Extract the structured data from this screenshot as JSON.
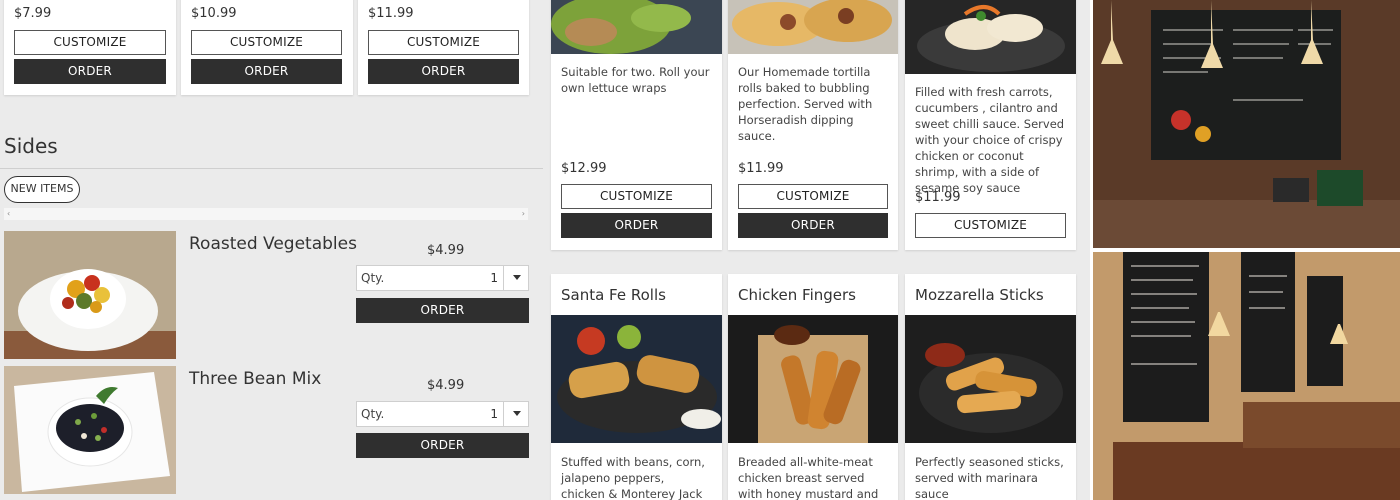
{
  "top_row": [
    {
      "price": "$7.99",
      "customize": "CUSTOMIZE",
      "order": "ORDER"
    },
    {
      "price": "$10.99",
      "customize": "CUSTOMIZE",
      "order": "ORDER"
    },
    {
      "price": "$11.99",
      "customize": "CUSTOMIZE",
      "order": "ORDER"
    }
  ],
  "sides": {
    "title": "Sides",
    "filter_pill": "NEW ITEMS",
    "items": [
      {
        "name": "Roasted Vegetables",
        "price": "$4.99",
        "qty_label": "Qty.",
        "qty_value": "1",
        "order": "ORDER"
      },
      {
        "name": "Three Bean Mix",
        "price": "$4.99",
        "qty_label": "Qty.",
        "qty_value": "1",
        "order": "ORDER"
      }
    ]
  },
  "mid_top": [
    {
      "desc": "Suitable for two. Roll your own lettuce wraps",
      "price": "$12.99",
      "customize": "CUSTOMIZE",
      "order": "ORDER"
    },
    {
      "desc": "Our Homemade tortilla rolls baked to bubbling perfection. Served with Horseradish dipping sauce.",
      "price": "$11.99",
      "customize": "CUSTOMIZE",
      "order": "ORDER"
    },
    {
      "desc": "Filled with fresh carrots, cucumbers , cilantro and sweet chilli sauce. Served with your choice of crispy chicken or coconut shrimp, with a side of sesame soy sauce",
      "price": "$11.99",
      "customize": "CUSTOMIZE"
    }
  ],
  "mid_bottom": [
    {
      "title": "Santa Fe Rolls",
      "desc": "Stuffed with beans, corn, jalapeno peppers, chicken & Monterey Jack cheese."
    },
    {
      "title": "Chicken Fingers",
      "desc": "Breaded all-white-meat chicken breast served with honey mustard and BBQ"
    },
    {
      "title": "Mozzarella Sticks",
      "desc": "Perfectly seasoned sticks, served with marinara sauce"
    }
  ],
  "colors": {
    "dark_button": "#2f2f2f",
    "page_bg": "#ebebeb"
  }
}
